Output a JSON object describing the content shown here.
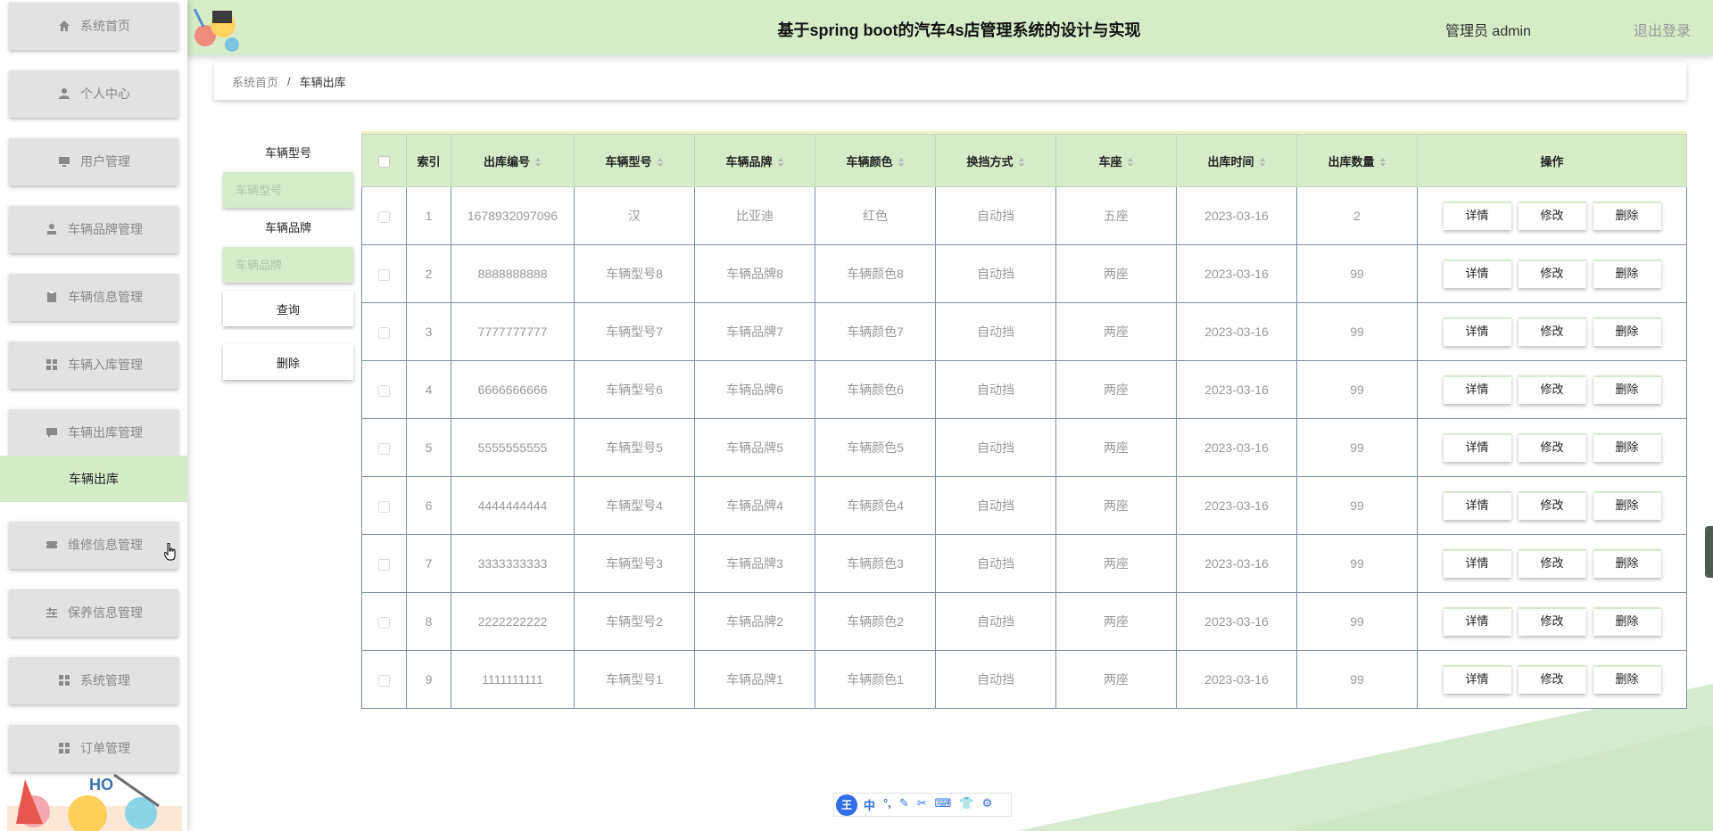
{
  "header": {
    "title": "基于spring boot的汽车4s店管理系统的设计与实现",
    "user": "管理员 admin",
    "logout": "退出登录"
  },
  "sidebar": {
    "items": [
      {
        "label": "系统首页",
        "icon": "home-icon"
      },
      {
        "label": "个人中心",
        "icon": "user-icon"
      },
      {
        "label": "用户管理",
        "icon": "monitor-icon"
      },
      {
        "label": "车辆品牌管理",
        "icon": "person-stamp-icon"
      },
      {
        "label": "车辆信息管理",
        "icon": "clipboard-icon"
      },
      {
        "label": "车辆入库管理",
        "icon": "grid-icon"
      },
      {
        "label": "车辆出库管理",
        "icon": "message-icon"
      },
      {
        "label": "维修信息管理",
        "icon": "ticket-icon"
      },
      {
        "label": "保养信息管理",
        "icon": "sliders-icon"
      },
      {
        "label": "系统管理",
        "icon": "grid-icon"
      },
      {
        "label": "订单管理",
        "icon": "grid-icon"
      }
    ],
    "active_sub": "车辆出库"
  },
  "breadcrumb": {
    "home": "系统首页",
    "separator": "/",
    "current": "车辆出库"
  },
  "filter": {
    "model_label": "车辆型号",
    "model_placeholder": "车辆型号",
    "brand_label": "车辆品牌",
    "brand_placeholder": "车辆品牌",
    "search_button": "查询",
    "delete_button": "删除"
  },
  "table": {
    "headers": [
      "索引",
      "出库编号",
      "车辆型号",
      "车辆品牌",
      "车辆颜色",
      "换挡方式",
      "车座",
      "出库时间",
      "出库数量",
      "操作"
    ],
    "rows": [
      [
        "1",
        "1678932097096",
        "汉",
        "比亚迪",
        "红色",
        "自动挡",
        "五座",
        "2023-03-16",
        "2"
      ],
      [
        "2",
        "8888888888",
        "车辆型号8",
        "车辆品牌8",
        "车辆颜色8",
        "自动挡",
        "两座",
        "2023-03-16",
        "99"
      ],
      [
        "3",
        "7777777777",
        "车辆型号7",
        "车辆品牌7",
        "车辆颜色7",
        "自动挡",
        "两座",
        "2023-03-16",
        "99"
      ],
      [
        "4",
        "6666666666",
        "车辆型号6",
        "车辆品牌6",
        "车辆颜色6",
        "自动挡",
        "两座",
        "2023-03-16",
        "99"
      ],
      [
        "5",
        "5555555555",
        "车辆型号5",
        "车辆品牌5",
        "车辆颜色5",
        "自动挡",
        "两座",
        "2023-03-16",
        "99"
      ],
      [
        "6",
        "4444444444",
        "车辆型号4",
        "车辆品牌4",
        "车辆颜色4",
        "自动挡",
        "两座",
        "2023-03-16",
        "99"
      ],
      [
        "7",
        "3333333333",
        "车辆型号3",
        "车辆品牌3",
        "车辆颜色3",
        "自动挡",
        "两座",
        "2023-03-16",
        "99"
      ],
      [
        "8",
        "2222222222",
        "车辆型号2",
        "车辆品牌2",
        "车辆颜色2",
        "自动挡",
        "两座",
        "2023-03-16",
        "99"
      ],
      [
        "9",
        "1111111111",
        "车辆型号1",
        "车辆品牌1",
        "车辆颜色1",
        "自动挡",
        "两座",
        "2023-03-16",
        "99"
      ]
    ],
    "actions": [
      "详情",
      "修改",
      "删除"
    ]
  },
  "ime": {
    "logo": "王",
    "icons": [
      "中",
      "°,",
      "✎",
      "✂",
      "⌨",
      "👕",
      "⚙"
    ]
  },
  "colors": {
    "accent": "#d6ebc9",
    "menu_bg": "#e2e2e2",
    "border": "#7f8ea8"
  }
}
